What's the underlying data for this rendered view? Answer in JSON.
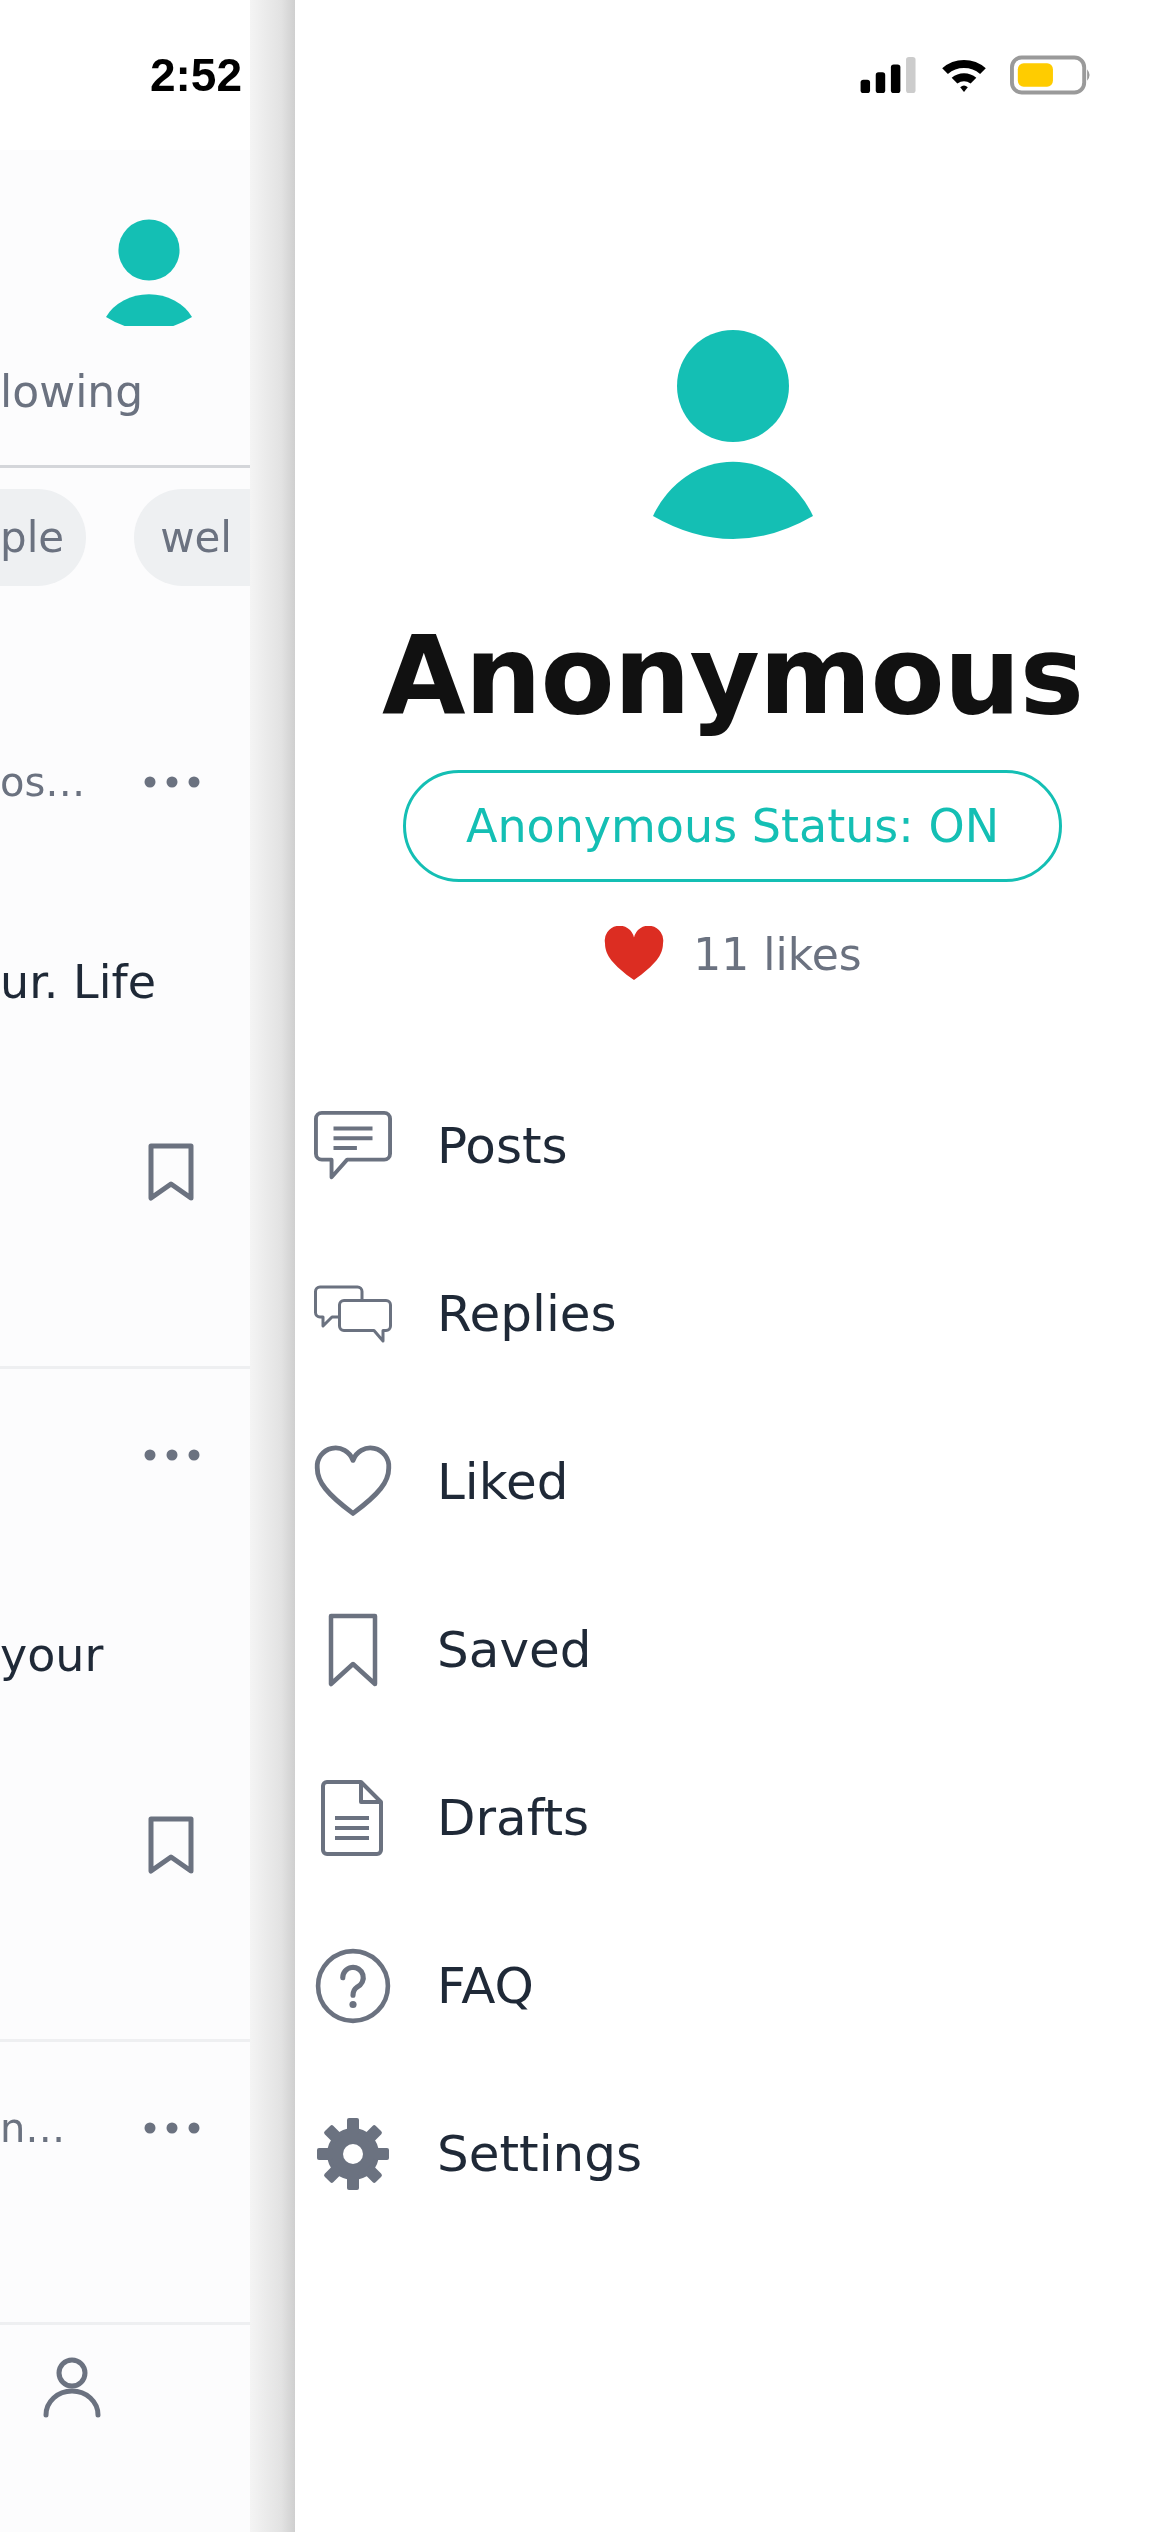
{
  "status_bar": {
    "time": "2:52"
  },
  "background_feed": {
    "tab_label": "lowing",
    "chips": [
      "ple",
      "wel"
    ],
    "posts": [
      {
        "meta": "os…",
        "body": "ur. Life",
        "bookmark": true
      },
      {
        "body": "your",
        "bookmark": true
      },
      {
        "meta": "n…",
        "bookmark": false
      }
    ]
  },
  "drawer": {
    "name": "Anonymous",
    "status_badge": "Anonymous Status: ON",
    "likes": "11 likes",
    "menu": [
      {
        "label": "Posts"
      },
      {
        "label": "Replies"
      },
      {
        "label": "Liked"
      },
      {
        "label": "Saved"
      },
      {
        "label": "Drafts"
      },
      {
        "label": "FAQ"
      },
      {
        "label": "Settings"
      }
    ]
  }
}
